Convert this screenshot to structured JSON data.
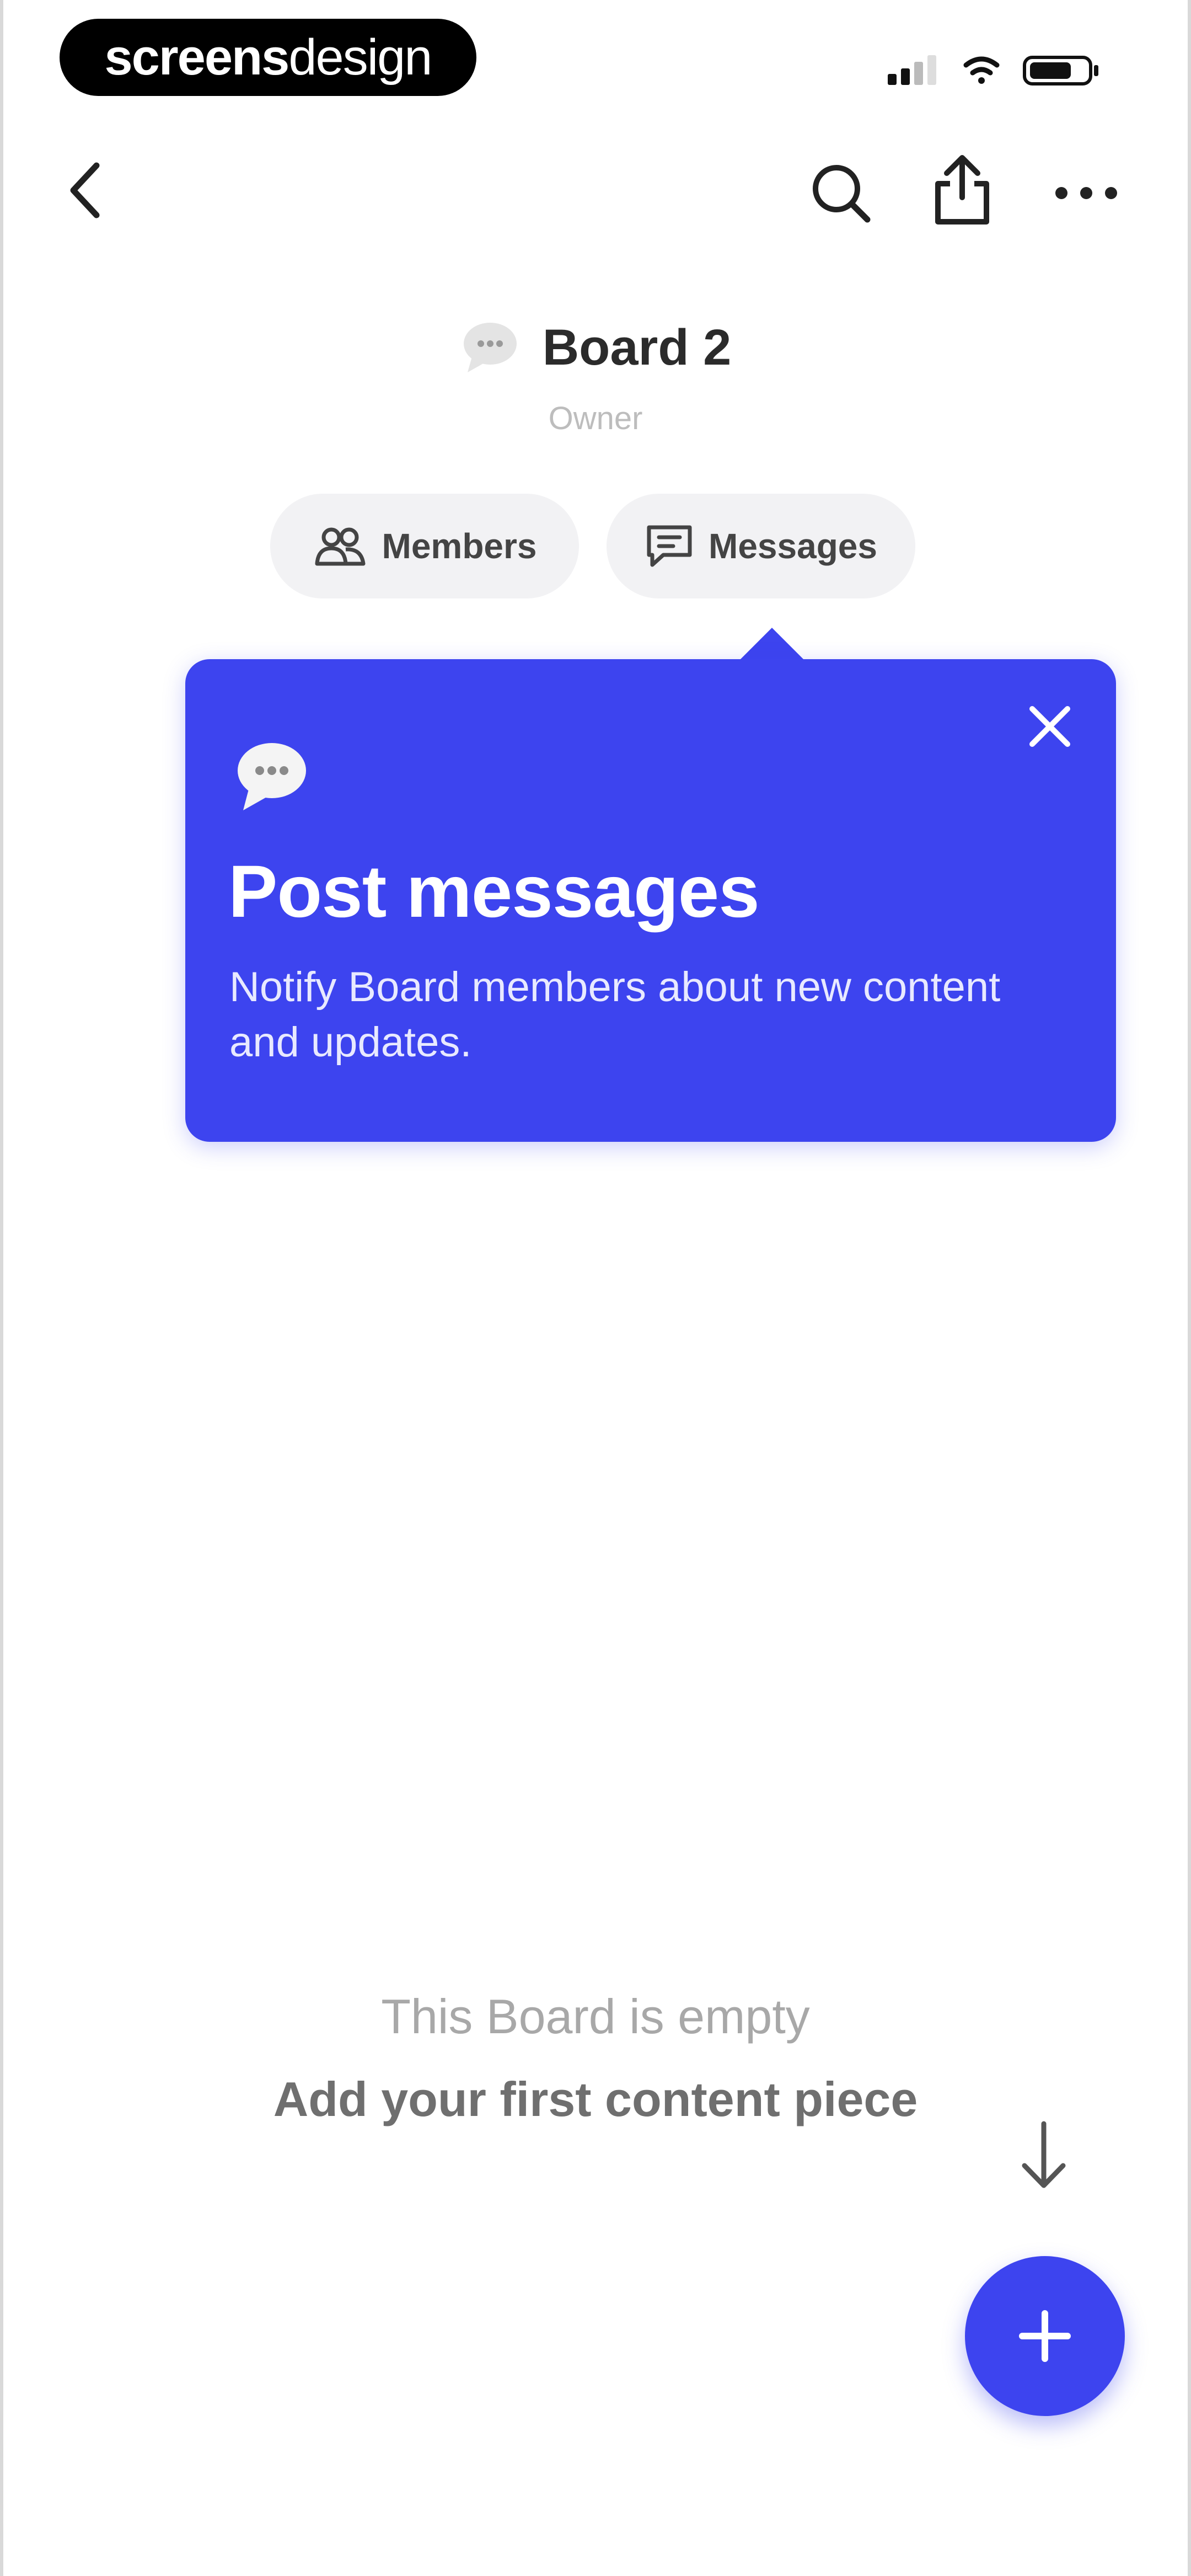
{
  "watermark": {
    "bold": "screens",
    "light": "design"
  },
  "header": {
    "board_title": "Board 2",
    "role": "Owner"
  },
  "pills": {
    "members": "Members",
    "messages": "Messages"
  },
  "tooltip": {
    "title": "Post messages",
    "body": "Notify Board members about new content and updates."
  },
  "empty_state": {
    "line1": "This Board is empty",
    "line2": "Add your first content piece"
  },
  "colors": {
    "accent": "#3d44ef",
    "pill_bg": "#f2f2f4",
    "text_dark": "#2b2b2b",
    "text_muted": "#bdbdbd"
  },
  "icons": {
    "back": "chevron-left-icon",
    "search": "search-icon",
    "share": "share-icon",
    "more": "more-horizontal-icon",
    "board": "speech-bubble-icon",
    "members": "members-icon",
    "messages": "message-icon",
    "close": "close-icon",
    "down": "arrow-down-icon",
    "add": "plus-icon"
  }
}
